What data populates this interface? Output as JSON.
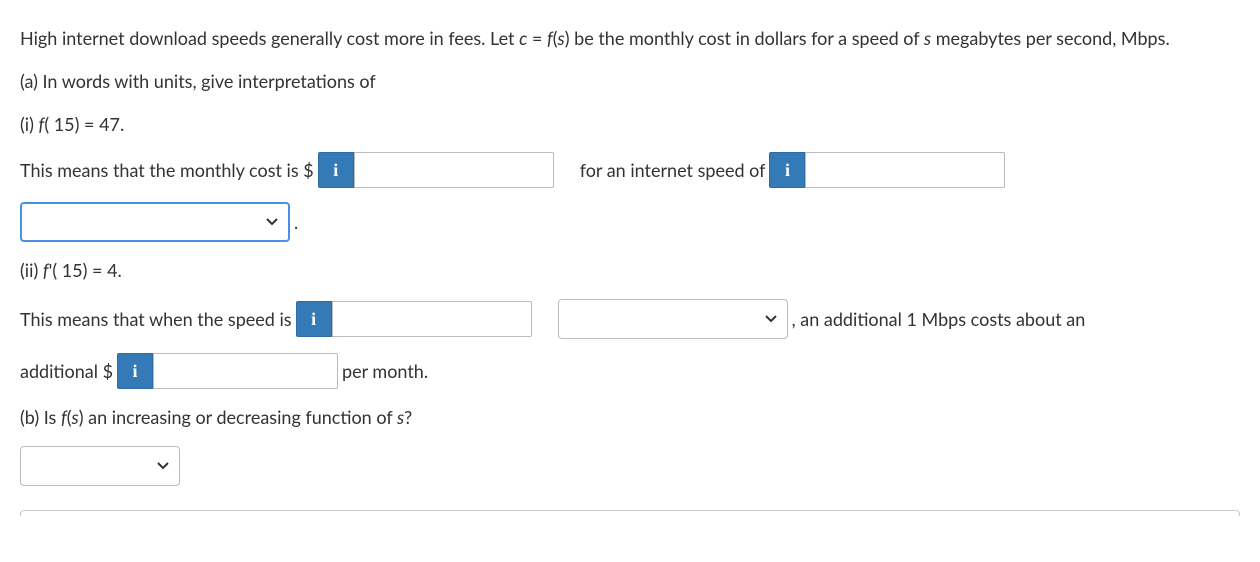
{
  "intro": {
    "line1a": "High internet download speeds generally cost more in fees. Let ",
    "line1b": "c",
    "line1c": " = ",
    "line1d": "f",
    "line1e": "(",
    "line1f": "s",
    "line1g": ") be the monthly cost in dollars for a speed of ",
    "line1h": "s",
    "line1i": " megabytes per second, Mbps."
  },
  "partA": {
    "label": "(a) In words with units, give interpretations of",
    "i": {
      "label_a": "(i) ",
      "label_b": "f",
      "label_c": "( 15) = 47.",
      "sentence1": "This means that the monthly cost is $",
      "sentence2": "for an internet speed of",
      "period": "."
    },
    "ii": {
      "label_a": "(ii) ",
      "label_b": "f",
      "label_c": "'( 15) = 4.",
      "sentence1": "This means that when the speed is",
      "comma": ",",
      "sentence2": " an additional 1 Mbps costs about an",
      "sentence3": "additional $",
      "sentence4": "per month."
    }
  },
  "partB": {
    "label_a": "(b) Is ",
    "label_b": "f",
    "label_c": "(",
    "label_d": "s",
    "label_e": ") an increasing or decreasing function of ",
    "label_f": "s",
    "label_g": "?"
  },
  "icons": {
    "info": "i"
  }
}
